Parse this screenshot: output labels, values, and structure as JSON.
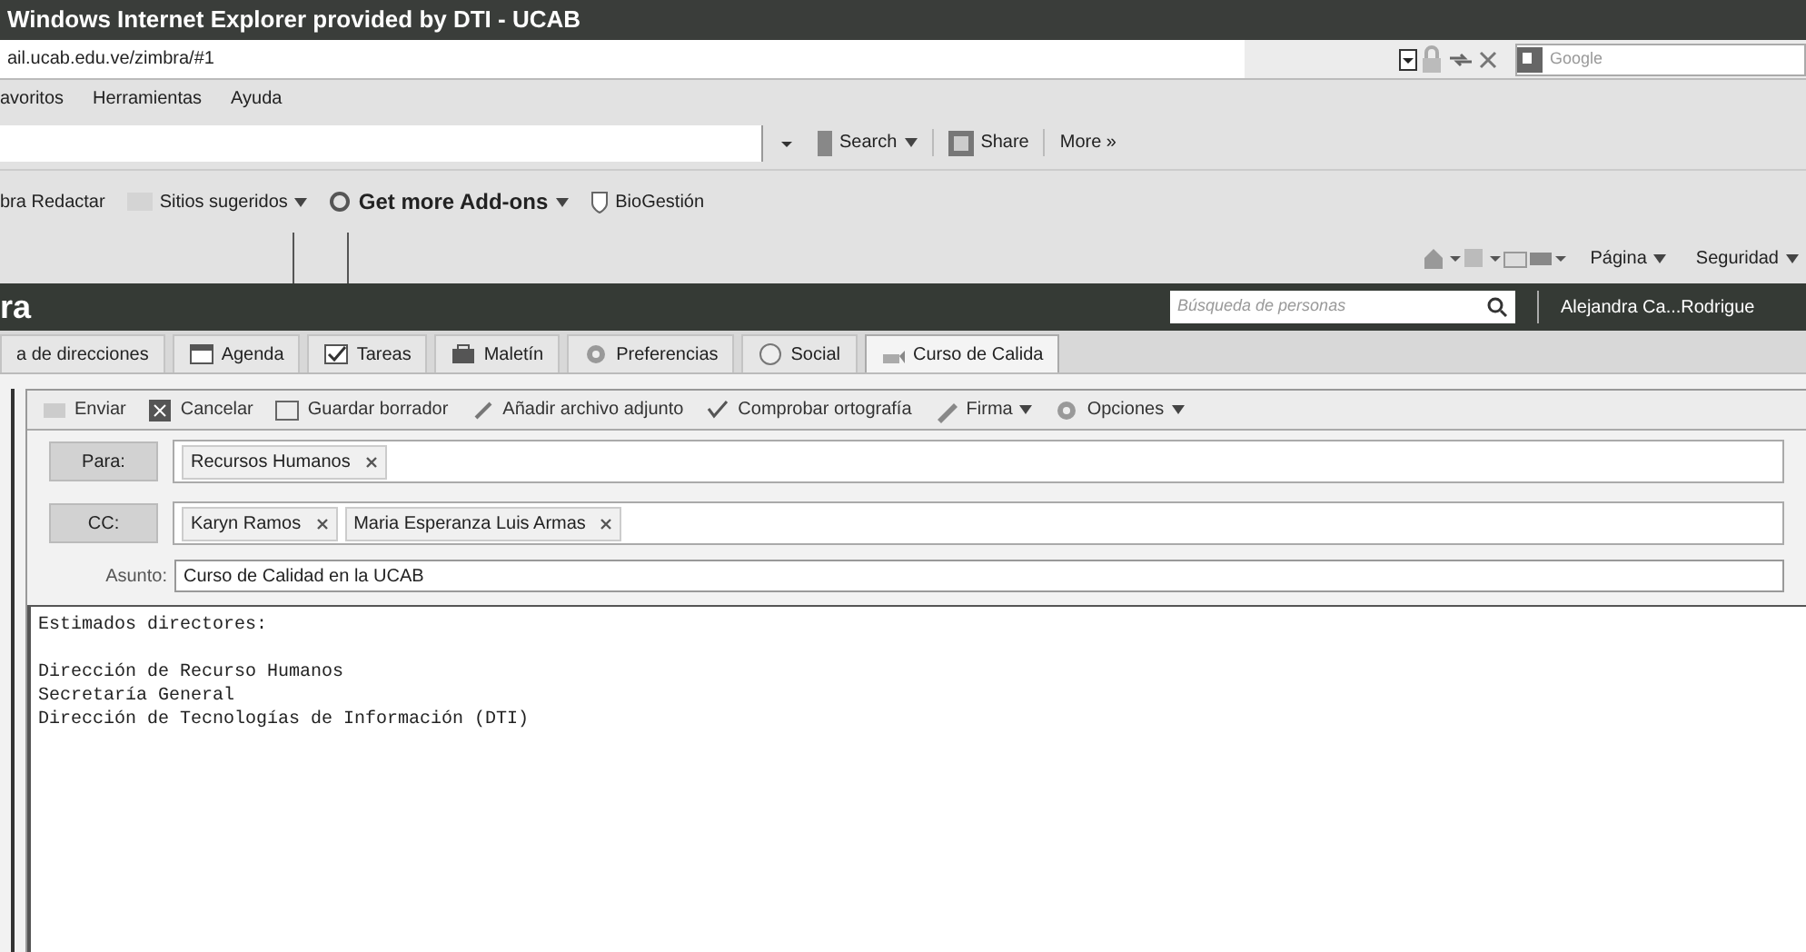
{
  "window": {
    "title": "Windows Internet Explorer provided by DTI - UCAB"
  },
  "address_bar": {
    "url": "ail.ucab.edu.ve/zimbra/#1",
    "search_placeholder": "Google"
  },
  "menu": [
    "avoritos",
    "Herramientas",
    "Ayuda"
  ],
  "toolbar": {
    "search": "Search",
    "share": "Share",
    "more": "More »"
  },
  "favorites": [
    {
      "label": "bra Redactar",
      "kind": "plain"
    },
    {
      "label": "Sitios sugeridos",
      "kind": "dropdown"
    },
    {
      "label": "Get more Add-ons",
      "kind": "bold"
    },
    {
      "label": "BioGestión",
      "kind": "shield"
    }
  ],
  "command_bar": [
    "Página",
    "Seguridad"
  ],
  "app": {
    "title": "ra",
    "search_placeholder": "Búsqueda de personas",
    "user": "Alejandra Ca...Rodrigue"
  },
  "tabs": [
    {
      "label": "a de direcciones",
      "selected": false
    },
    {
      "label": "Agenda",
      "selected": false
    },
    {
      "label": "Tareas",
      "selected": false
    },
    {
      "label": "Maletín",
      "selected": false
    },
    {
      "label": "Preferencias",
      "selected": false
    },
    {
      "label": "Social",
      "selected": false
    },
    {
      "label": "Curso de Calida",
      "selected": true
    }
  ],
  "compose_toolbar": [
    "Enviar",
    "Cancelar",
    "Guardar borrador",
    "Añadir archivo adjunto",
    "Comprobar ortografía",
    "Firma",
    "Opciones"
  ],
  "to": {
    "label": "Para:",
    "recipients": [
      "Recursos Humanos"
    ]
  },
  "cc": {
    "label": "CC:",
    "recipients": [
      "Karyn Ramos",
      "Maria Esperanza Luis Armas"
    ]
  },
  "subject": {
    "label": "Asunto:",
    "value": "Curso de Calidad en la UCAB"
  },
  "body": {
    "greeting": "Estimados directores:",
    "lines": [
      "Dirección de Recurso Humanos",
      "Secretaría General",
      "Dirección de Tecnologías de Información (DTI)"
    ]
  }
}
